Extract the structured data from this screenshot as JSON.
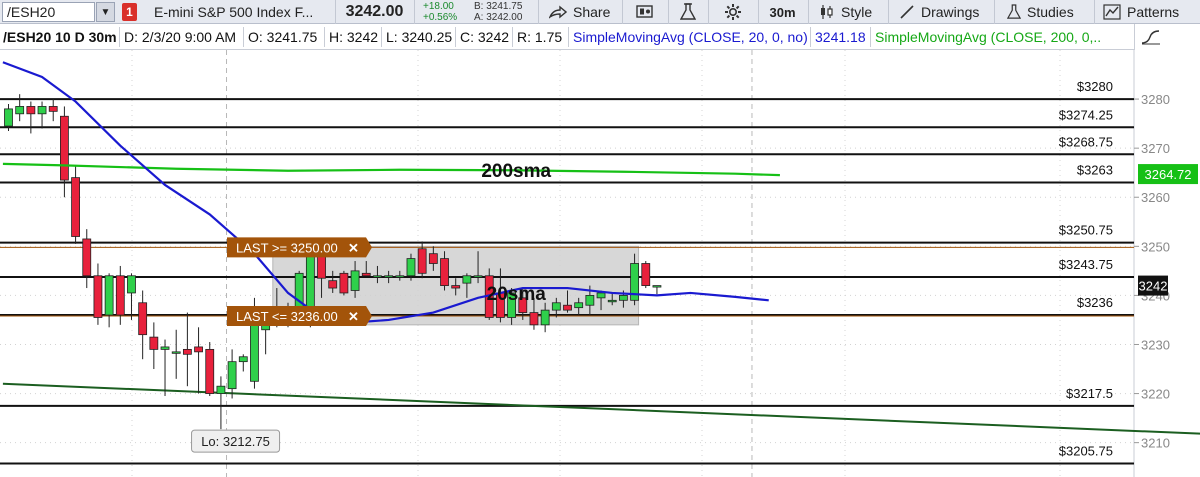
{
  "toolbar": {
    "symbol": "/ESH20",
    "dropdown_glyph": "▼",
    "flag": "1",
    "description": "E-mini S&P 500 Index F...",
    "last_price": "3242.00",
    "change": "+18.00",
    "change_pct": "+0.56%",
    "bid": "B: 3241.75",
    "ask": "A: 3242.00",
    "share_label": "Share",
    "interval_label": "30m",
    "style_label": "Style",
    "drawings_label": "Drawings",
    "studies_label": "Studies",
    "patterns_label": "Patterns"
  },
  "infobar": {
    "symbol_period": "/ESH20 10 D 30m",
    "date": "D: 2/3/20 9:00 AM",
    "open": "O: 3241.75",
    "high": "H: 3242",
    "low": "L: 3240.25",
    "close": "C: 3242",
    "range": "R: 1.75",
    "sma20_label": "SimpleMovingAvg (CLOSE, 20, 0, no)",
    "sma20_value": "3241.18",
    "sma200_label": "SimpleMovingAvg (CLOSE, 200, 0,..."
  },
  "colors": {
    "up_candle": "#2fd04b",
    "down_candle": "#e8213c",
    "sma20": "#1a1ad0",
    "sma200": "#16c016",
    "trendline": "#1b5e20",
    "level_line": "#111111",
    "alert_fill": "#a3540a",
    "range_box": "#d0d0d0"
  },
  "chart_data": {
    "type": "candlestick",
    "symbol": "/ESH20",
    "interval": "30m",
    "ylim": [
      3203,
      3290
    ],
    "y_ticks": [
      3210,
      3220,
      3230,
      3240,
      3250,
      3260,
      3270,
      3280
    ],
    "horizontal_levels": [
      {
        "price": 3280,
        "label": "$3280"
      },
      {
        "price": 3274.25,
        "label": "$3274.25"
      },
      {
        "price": 3268.75,
        "label": "$3268.75"
      },
      {
        "price": 3263,
        "label": "$3263"
      },
      {
        "price": 3250.75,
        "label": "$3250.75"
      },
      {
        "price": 3243.75,
        "label": "$3243.75"
      },
      {
        "price": 3236,
        "label": "$3236"
      },
      {
        "price": 3217.5,
        "label": "$3217.5"
      },
      {
        "price": 3205.75,
        "label": "$3205.75"
      }
    ],
    "alerts": [
      {
        "label": "LAST >= 3250.00",
        "price": 3250
      },
      {
        "label": "LAST <= 3236.00",
        "price": 3236
      }
    ],
    "range_box": {
      "top": 3250,
      "bottom": 3234,
      "bar_from": 24,
      "bar_to": 56
    },
    "price_tags": [
      {
        "text": "3264.72",
        "price": 3264.72,
        "bg": "#16c016",
        "fg": "#ffffff"
      },
      {
        "text": "3242",
        "price": 3242,
        "bg": "#111111",
        "fg": "#ffffff"
      }
    ],
    "annotations": [
      {
        "text": "200sma",
        "bar": 43,
        "price": 3265.5
      },
      {
        "text": "20sma",
        "bar": 43,
        "price": 3240.5
      }
    ],
    "low_callout": {
      "text": "Lo: 3212.75",
      "bar": 17,
      "price": 3212.75
    },
    "sessions_at_bar": [
      19,
      66
    ],
    "candles": [
      {
        "o": 3274.5,
        "h": 3279.0,
        "l": 3273.5,
        "c": 3278.0
      },
      {
        "o": 3277.0,
        "h": 3281.0,
        "l": 3275.5,
        "c": 3278.5
      },
      {
        "o": 3278.5,
        "h": 3279.5,
        "l": 3273.0,
        "c": 3277.0
      },
      {
        "o": 3277.0,
        "h": 3279.5,
        "l": 3274.0,
        "c": 3278.5
      },
      {
        "o": 3278.5,
        "h": 3280.0,
        "l": 3275.5,
        "c": 3277.5
      },
      {
        "o": 3276.5,
        "h": 3278.5,
        "l": 3260.0,
        "c": 3263.5
      },
      {
        "o": 3264.0,
        "h": 3266.5,
        "l": 3250.5,
        "c": 3252.0
      },
      {
        "o": 3251.5,
        "h": 3253.5,
        "l": 3241.5,
        "c": 3244.0
      },
      {
        "o": 3244.0,
        "h": 3246.5,
        "l": 3234.0,
        "c": 3235.5
      },
      {
        "o": 3236.0,
        "h": 3244.5,
        "l": 3233.5,
        "c": 3244.0
      },
      {
        "o": 3244.0,
        "h": 3246.0,
        "l": 3234.0,
        "c": 3236.0
      },
      {
        "o": 3240.5,
        "h": 3244.5,
        "l": 3235.0,
        "c": 3244.0
      },
      {
        "o": 3238.5,
        "h": 3241.0,
        "l": 3227.0,
        "c": 3232.0
      },
      {
        "o": 3231.5,
        "h": 3234.5,
        "l": 3225.0,
        "c": 3229.0
      },
      {
        "o": 3229.0,
        "h": 3231.0,
        "l": 3219.5,
        "c": 3229.5
      },
      {
        "o": 3228.5,
        "h": 3233.0,
        "l": 3223.0,
        "c": 3228.5
      },
      {
        "o": 3229.0,
        "h": 3236.5,
        "l": 3221.5,
        "c": 3228.0
      },
      {
        "o": 3229.5,
        "h": 3233.5,
        "l": 3220.0,
        "c": 3228.5
      },
      {
        "o": 3229.0,
        "h": 3230.5,
        "l": 3219.5,
        "c": 3220.0
      },
      {
        "o": 3220.0,
        "h": 3223.5,
        "l": 3212.75,
        "c": 3221.5
      },
      {
        "o": 3221.0,
        "h": 3229.0,
        "l": 3219.0,
        "c": 3226.5
      },
      {
        "o": 3226.5,
        "h": 3228.0,
        "l": 3224.5,
        "c": 3227.5
      },
      {
        "o": 3222.5,
        "h": 3239.5,
        "l": 3221.0,
        "c": 3236.0
      },
      {
        "o": 3233.0,
        "h": 3236.5,
        "l": 3228.0,
        "c": 3234.5
      },
      {
        "o": 3234.5,
        "h": 3241.5,
        "l": 3233.5,
        "c": 3236.5
      },
      {
        "o": 3236.0,
        "h": 3238.5,
        "l": 3233.5,
        "c": 3234.0
      },
      {
        "o": 3235.0,
        "h": 3245.0,
        "l": 3234.0,
        "c": 3244.5
      },
      {
        "o": 3234.5,
        "h": 3251.0,
        "l": 3233.5,
        "c": 3250.0
      },
      {
        "o": 3249.0,
        "h": 3250.5,
        "l": 3239.5,
        "c": 3243.5
      },
      {
        "o": 3243.0,
        "h": 3245.0,
        "l": 3240.5,
        "c": 3241.5
      },
      {
        "o": 3244.5,
        "h": 3245.0,
        "l": 3240.0,
        "c": 3240.5
      },
      {
        "o": 3241.0,
        "h": 3247.0,
        "l": 3239.5,
        "c": 3245.0
      },
      {
        "o": 3244.5,
        "h": 3247.0,
        "l": 3244.0,
        "c": 3244.0
      },
      {
        "o": 3244.0,
        "h": 3246.0,
        "l": 3242.5,
        "c": 3244.0
      },
      {
        "o": 3244.0,
        "h": 3245.0,
        "l": 3242.5,
        "c": 3244.0
      },
      {
        "o": 3244.0,
        "h": 3245.0,
        "l": 3243.0,
        "c": 3244.0
      },
      {
        "o": 3244.0,
        "h": 3248.5,
        "l": 3243.0,
        "c": 3247.5
      },
      {
        "o": 3249.5,
        "h": 3251.0,
        "l": 3243.5,
        "c": 3244.5
      },
      {
        "o": 3248.5,
        "h": 3250.0,
        "l": 3245.0,
        "c": 3246.5
      },
      {
        "o": 3247.5,
        "h": 3249.0,
        "l": 3241.0,
        "c": 3242.0
      },
      {
        "o": 3242.0,
        "h": 3243.5,
        "l": 3240.0,
        "c": 3241.5
      },
      {
        "o": 3242.5,
        "h": 3244.5,
        "l": 3239.5,
        "c": 3244.0
      },
      {
        "o": 3244.0,
        "h": 3249.0,
        "l": 3242.5,
        "c": 3244.0
      },
      {
        "o": 3244.0,
        "h": 3245.5,
        "l": 3235.0,
        "c": 3235.5
      },
      {
        "o": 3240.5,
        "h": 3245.5,
        "l": 3234.5,
        "c": 3235.5
      },
      {
        "o": 3235.5,
        "h": 3241.5,
        "l": 3234.0,
        "c": 3240.5
      },
      {
        "o": 3239.5,
        "h": 3241.5,
        "l": 3235.0,
        "c": 3236.5
      },
      {
        "o": 3236.5,
        "h": 3239.5,
        "l": 3233.0,
        "c": 3234.0
      },
      {
        "o": 3234.0,
        "h": 3238.5,
        "l": 3232.5,
        "c": 3237.0
      },
      {
        "o": 3237.0,
        "h": 3239.5,
        "l": 3235.5,
        "c": 3238.5
      },
      {
        "o": 3238.0,
        "h": 3241.0,
        "l": 3236.5,
        "c": 3237.0
      },
      {
        "o": 3237.5,
        "h": 3239.5,
        "l": 3236.0,
        "c": 3238.5
      },
      {
        "o": 3238.0,
        "h": 3242.0,
        "l": 3236.0,
        "c": 3240.0
      },
      {
        "o": 3239.5,
        "h": 3241.0,
        "l": 3237.0,
        "c": 3240.5
      },
      {
        "o": 3239.0,
        "h": 3240.5,
        "l": 3238.0,
        "c": 3239.0
      },
      {
        "o": 3239.0,
        "h": 3241.0,
        "l": 3237.5,
        "c": 3240.0
      },
      {
        "o": 3239.0,
        "h": 3248.5,
        "l": 3238.0,
        "c": 3246.5
      },
      {
        "o": 3246.5,
        "h": 3247.0,
        "l": 3241.5,
        "c": 3242.0
      },
      {
        "o": 3242.0,
        "h": 3242.0,
        "l": 3240.25,
        "c": 3242.0
      }
    ],
    "sma20": [
      {
        "bar": -0.5,
        "v": 3287.5
      },
      {
        "bar": 3,
        "v": 3284.5
      },
      {
        "bar": 6,
        "v": 3279.5
      },
      {
        "bar": 10,
        "v": 3270.5
      },
      {
        "bar": 14,
        "v": 3262.5
      },
      {
        "bar": 18,
        "v": 3256.5
      },
      {
        "bar": 22,
        "v": 3248.5
      },
      {
        "bar": 25,
        "v": 3240.5
      },
      {
        "bar": 28,
        "v": 3235.5
      },
      {
        "bar": 31,
        "v": 3234.5
      },
      {
        "bar": 34,
        "v": 3235.0
      },
      {
        "bar": 38,
        "v": 3236.5
      },
      {
        "bar": 42,
        "v": 3239.5
      },
      {
        "bar": 46,
        "v": 3241.5
      },
      {
        "bar": 50,
        "v": 3241.5
      },
      {
        "bar": 54,
        "v": 3240.5
      },
      {
        "bar": 58,
        "v": 3240.0
      },
      {
        "bar": 61,
        "v": 3240.5
      },
      {
        "bar": 65,
        "v": 3239.7
      },
      {
        "bar": 68,
        "v": 3239.0
      }
    ],
    "sma200": [
      {
        "bar": -0.5,
        "v": 3266.8
      },
      {
        "bar": 5,
        "v": 3266.5
      },
      {
        "bar": 15,
        "v": 3265.8
      },
      {
        "bar": 25,
        "v": 3265.4
      },
      {
        "bar": 35,
        "v": 3265.6
      },
      {
        "bar": 45,
        "v": 3265.5
      },
      {
        "bar": 55,
        "v": 3265.2
      },
      {
        "bar": 65,
        "v": 3264.8
      },
      {
        "bar": 69,
        "v": 3264.5
      }
    ],
    "trendline": {
      "from": {
        "bar": -0.5,
        "v": 3222.0
      },
      "to": {
        "bar": 110,
        "v": 3211.5
      }
    }
  }
}
